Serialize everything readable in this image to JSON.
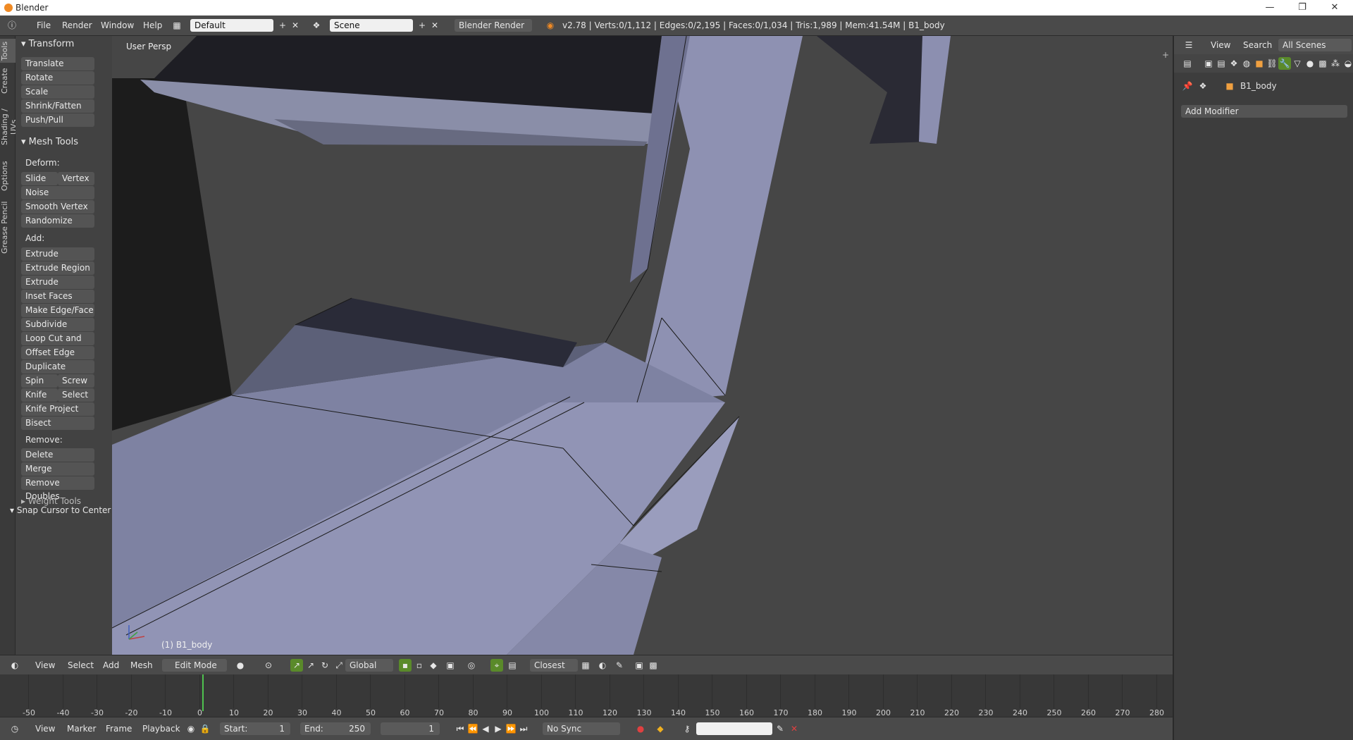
{
  "window": {
    "title": "Blender",
    "min": "—",
    "max": "❐",
    "close": "✕"
  },
  "info_header": {
    "menus": [
      "File",
      "Render",
      "Window",
      "Help"
    ],
    "layout_value": "Default",
    "scene_value": "Scene",
    "render_engine": "Blender Render",
    "stats": "v2.78 | Verts:0/1,112 | Edges:0/2,195 | Faces:0/1,034 | Tris:1,989 | Mem:41.54M | B1_body"
  },
  "side_tabs": [
    "Tools",
    "Create",
    "Shading / UVs",
    "Options",
    "Grease Pencil"
  ],
  "tool_shelf": {
    "transform_header": "Transform",
    "transform_buttons": [
      "Translate",
      "Rotate",
      "Scale",
      "Shrink/Fatten",
      "Push/Pull"
    ],
    "mesh_tools_header": "Mesh Tools",
    "deform_label": "Deform:",
    "deform_row": [
      "Slide Ed",
      "Vertex"
    ],
    "deform_buttons": [
      "Noise",
      "Smooth Vertex",
      "Randomize"
    ],
    "add_label": "Add:",
    "add_buttons": [
      "Extrude",
      "Extrude Region",
      "Extrude Individual",
      "Inset Faces",
      "Make Edge/Face",
      "Subdivide",
      "Loop Cut and Slide",
      "Offset Edge Slide",
      "Duplicate"
    ],
    "spin_row": [
      "Spin",
      "Screw"
    ],
    "knife_row": [
      "Knife",
      "Select"
    ],
    "add_buttons_2": [
      "Knife Project",
      "Bisect"
    ],
    "remove_label": "Remove:",
    "remove_buttons": [
      "Delete",
      "Merge",
      "Remove Doubles"
    ],
    "weight_tools_header": "Weight Tools",
    "snap_header": "Snap Cursor to Center"
  },
  "viewport": {
    "view_label": "User Persp",
    "object_label": "(1) B1_body",
    "colors": {
      "mesh": "#8c8fb0",
      "mesh_dark": "#2a2a3a",
      "bg": "#464646"
    }
  },
  "view3d_header": {
    "menus": [
      "View",
      "Select",
      "Add",
      "Mesh"
    ],
    "mode": "Edit Mode",
    "orientation": "Global",
    "snap_target": "Closest"
  },
  "timeline": {
    "ticks": [
      "-50",
      "-40",
      "-30",
      "-20",
      "-10",
      "0",
      "10",
      "20",
      "30",
      "40",
      "50",
      "60",
      "70",
      "80",
      "90",
      "100",
      "110",
      "120",
      "130",
      "140",
      "150",
      "160",
      "170",
      "180",
      "190",
      "200",
      "210",
      "220",
      "230",
      "240",
      "250",
      "260",
      "270",
      "280"
    ],
    "current_frame_marker": 0
  },
  "timeline_header": {
    "menus": [
      "View",
      "Marker",
      "Frame",
      "Playback"
    ],
    "start_label": "Start:",
    "start_value": "1",
    "end_label": "End:",
    "end_value": "250",
    "current_frame": "1",
    "sync": "No Sync"
  },
  "properties": {
    "menus": [
      "View",
      "Search"
    ],
    "filter": "All Scenes",
    "object_name": "B1_body",
    "add_modifier": "Add Modifier"
  }
}
